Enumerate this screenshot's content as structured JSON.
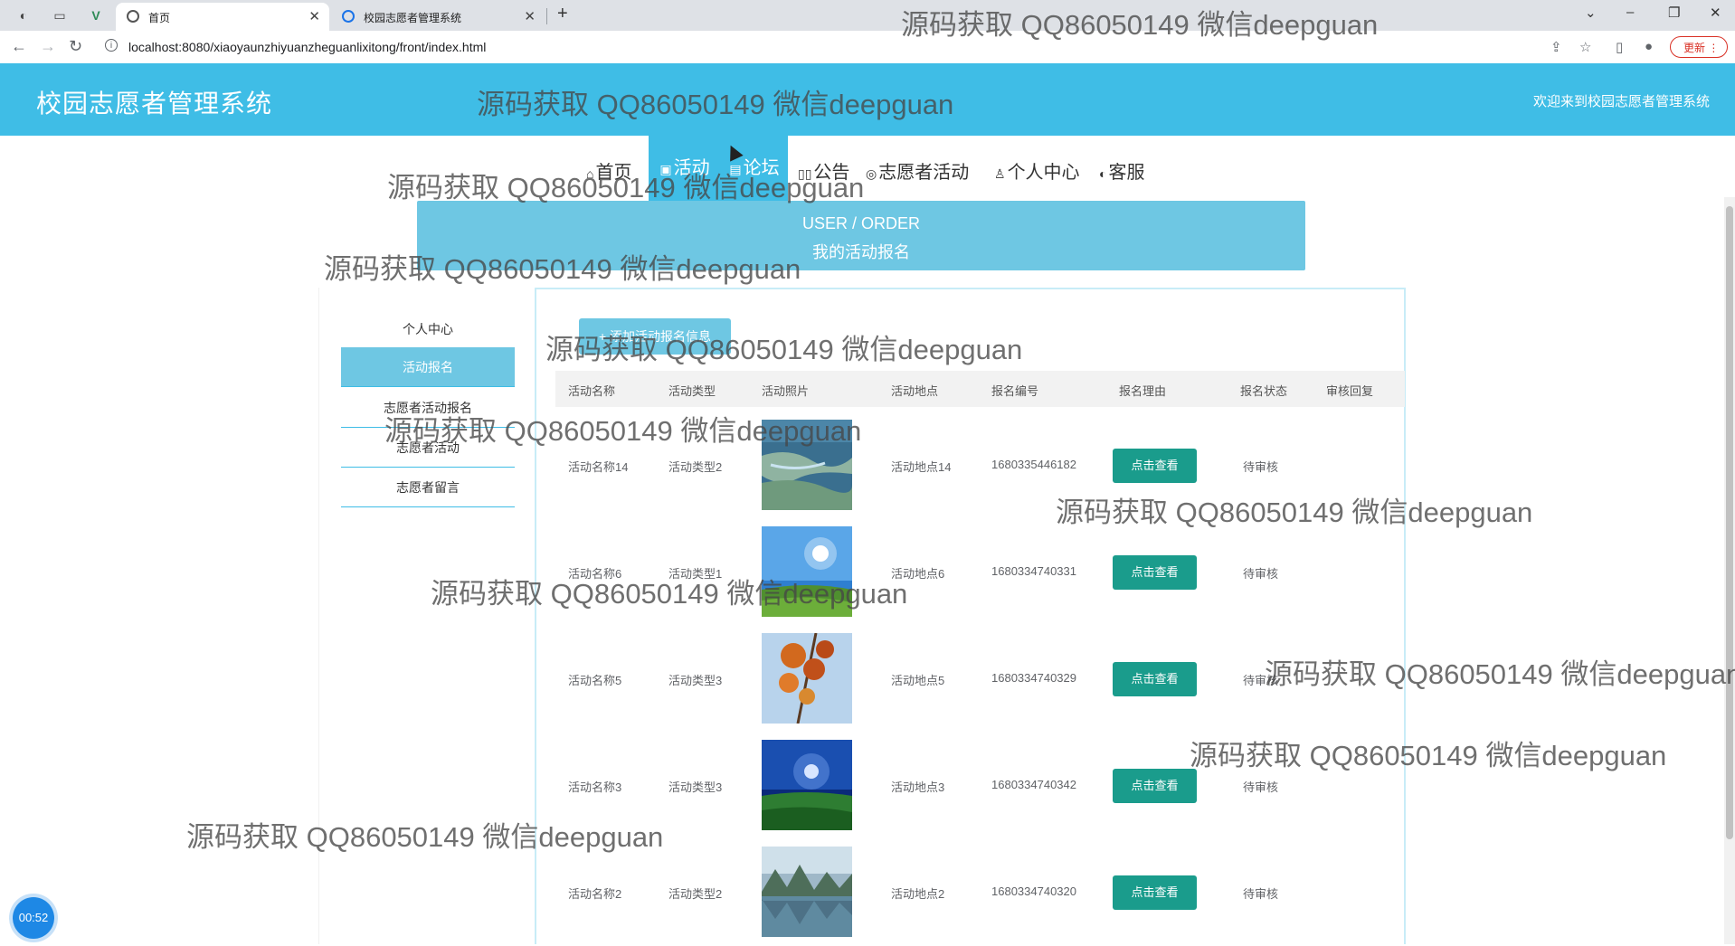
{
  "browser": {
    "tabs": [
      {
        "title": "首页",
        "active": true
      },
      {
        "title": "校园志愿者管理系统",
        "active": false
      }
    ],
    "url": "localhost:8080/xiaoyaunzhiyuanzheguanlixitong/front/index.html",
    "update_label": "更新"
  },
  "header": {
    "title": "校园志愿者管理系统",
    "welcome": "欢迎来到校园志愿者管理系统"
  },
  "nav": {
    "items": [
      "首页",
      "活动",
      "论坛",
      "公告",
      "志愿者活动",
      "个人中心",
      "客服"
    ],
    "active_index": 1
  },
  "banner": {
    "line1": "USER / ORDER",
    "line2": "我的活动报名"
  },
  "sidebar": {
    "items": [
      "个人中心",
      "活动报名",
      "志愿者活动报名",
      "志愿者活动",
      "志愿者留言"
    ],
    "active_index": 1
  },
  "content": {
    "add_button": "+ 添加活动报名信息",
    "columns": [
      "活动名称",
      "活动类型",
      "活动照片",
      "活动地点",
      "报名编号",
      "报名理由",
      "报名状态",
      "审核回复"
    ],
    "view_label": "点击查看",
    "rows": [
      {
        "name": "活动名称14",
        "type": "活动类型2",
        "photo": "lake-meadow",
        "place": "活动地点14",
        "no": "1680335446182",
        "status": "待审核"
      },
      {
        "name": "活动名称6",
        "type": "活动类型1",
        "photo": "sun-sky",
        "place": "活动地点6",
        "no": "1680334740331",
        "status": "待审核"
      },
      {
        "name": "活动名称5",
        "type": "活动类型3",
        "photo": "autumn-leaves",
        "place": "活动地点5",
        "no": "1680334740329",
        "status": "待审核"
      },
      {
        "name": "活动名称3",
        "type": "活动类型3",
        "photo": "night-field",
        "place": "活动地点3",
        "no": "1680334740342",
        "status": "待审核"
      },
      {
        "name": "活动名称2",
        "type": "活动类型2",
        "photo": "mountain-lake",
        "place": "活动地点2",
        "no": "1680334740320",
        "status": "待审核"
      }
    ]
  },
  "timer": "00:52",
  "watermark": "源码获取 QQ86050149 微信deepguan",
  "colors": {
    "primary": "#3fbde6",
    "banner": "#6ec7e3",
    "button": "#1a9c8c"
  }
}
